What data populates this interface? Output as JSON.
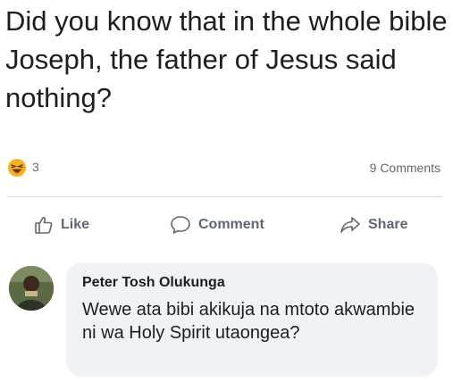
{
  "post": {
    "text": "Did you know that in the whole bible Joseph, the father of Jesus said nothing?"
  },
  "stats": {
    "reaction_icon": "haha-emoji-icon",
    "reaction_count": "3",
    "comments_label": "9 Comments"
  },
  "actions": {
    "like_label": "Like",
    "comment_label": "Comment",
    "share_label": "Share"
  },
  "comment": {
    "author": "Peter Tosh Olukunga",
    "text": "Wewe ata bibi akikuja na mtoto akwambie ni wa Holy Spirit utaongea?"
  },
  "colors": {
    "text": "#1c1e21",
    "secondary_text": "#65676b",
    "bubble_bg": "#f0f2f5",
    "divider": "#dadde1"
  }
}
